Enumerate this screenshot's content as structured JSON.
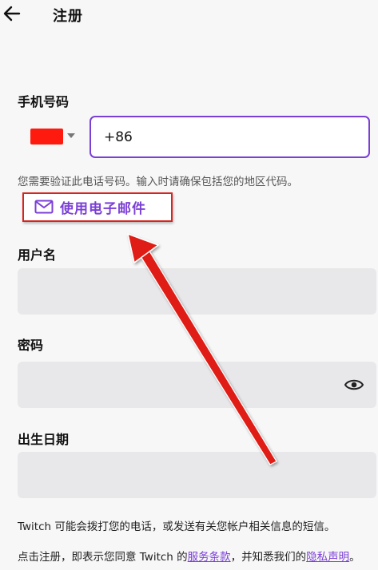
{
  "header": {
    "title": "注册"
  },
  "phone": {
    "label": "手机号码",
    "value": "+86",
    "hint": "您需要验证此电话号码。输入时请确保包括您的地区代码。"
  },
  "email_link": {
    "label": "使用电子邮件"
  },
  "username": {
    "label": "用户名",
    "value": ""
  },
  "password": {
    "label": "密码",
    "value": ""
  },
  "birthdate": {
    "label": "出生日期",
    "value": ""
  },
  "footer": {
    "sms_notice": "Twitch 可能会拨打您的电话，或发送有关您帐户相关信息的短信。",
    "terms_prefix": "点击注册，即表示您同意 Twitch 的",
    "terms_link": "服务条款",
    "terms_middle": "，并知悉我们的",
    "privacy_link": "隐私声明",
    "terms_suffix": "。"
  },
  "colors": {
    "accent": "#7b3fd6",
    "annotation": "#e01b14",
    "flag": "#ff1a0f"
  },
  "icons": {
    "back": "arrow-left-icon",
    "email": "mail-icon",
    "visibility": "eye-icon",
    "country_caret": "caret-down-icon"
  }
}
